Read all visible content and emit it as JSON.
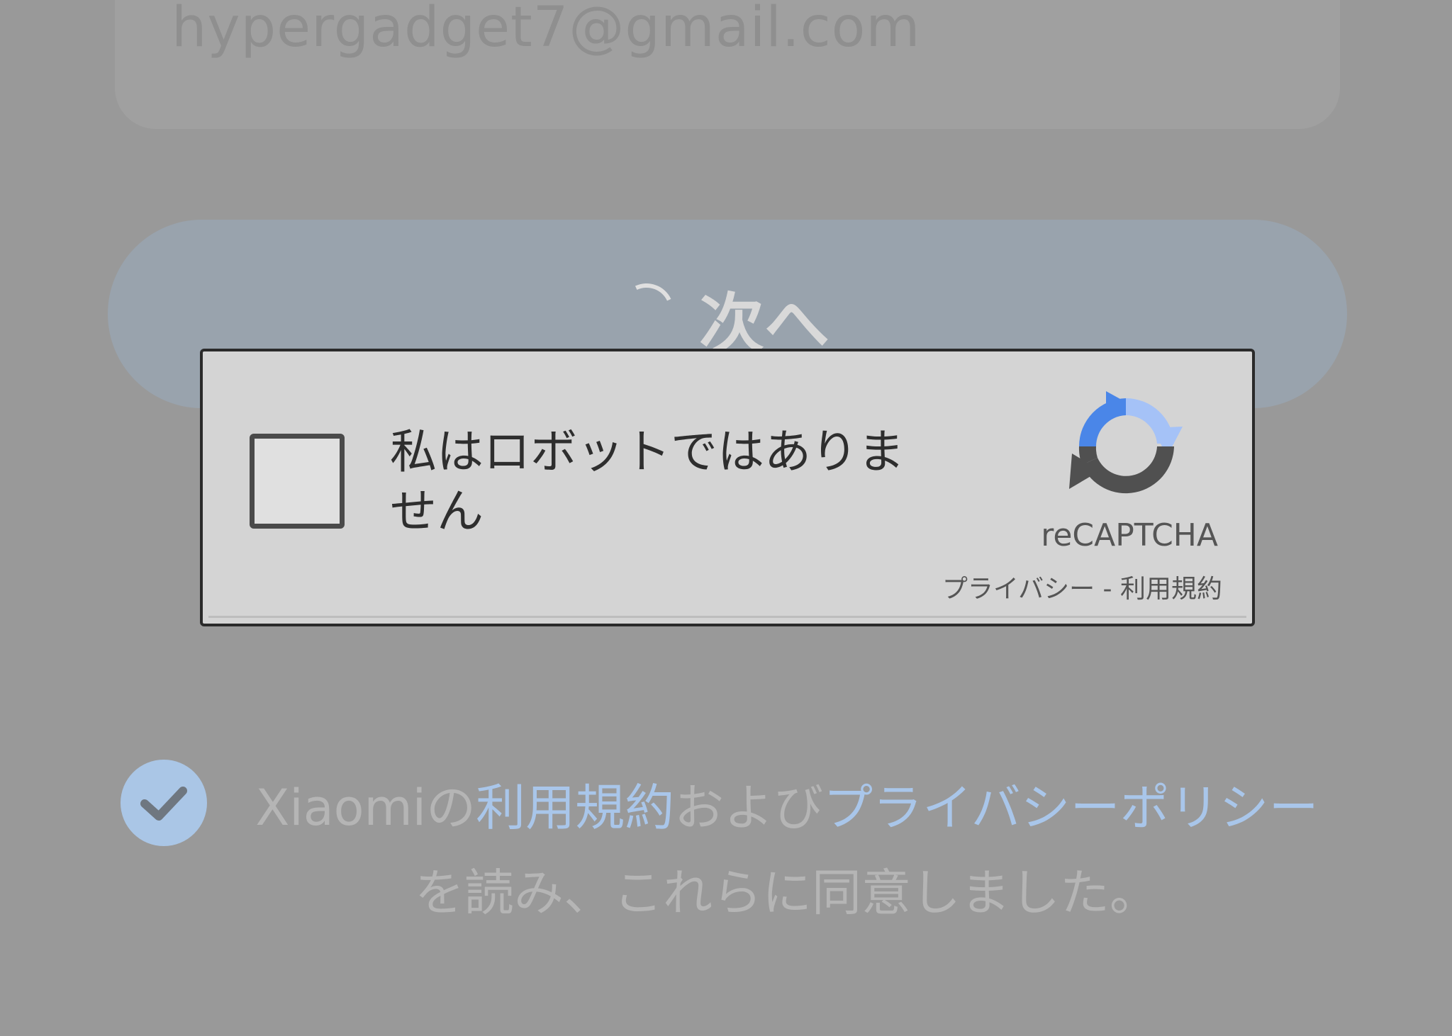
{
  "email": {
    "value": "hypergadget7@gmail.com"
  },
  "next_button": {
    "label": "次へ"
  },
  "captcha": {
    "label": "私はロボットではありません",
    "brand": "reCAPTCHA",
    "privacy_link": "プライバシー",
    "separator": " - ",
    "terms_link": "利用規約",
    "checked": false
  },
  "agreement": {
    "checked": true,
    "prefix": "Xiaomiの",
    "terms_link": "利用規約",
    "conjunction": "および",
    "privacy_link": "プライバシーポリシー",
    "suffix": "を読み、これらに同意しました。"
  },
  "colors": {
    "overlay": "#999999",
    "link": "#a9c6ea",
    "check_badge": "#aac6e6",
    "recaptcha_blue": "#4a86e8",
    "recaptcha_light_blue": "#a5c2f7",
    "recaptcha_gray": "#505050"
  },
  "icons": {
    "spinner": "loading-spinner-icon",
    "recaptcha": "recaptcha-logo-icon",
    "agree": "checkmark-icon"
  }
}
